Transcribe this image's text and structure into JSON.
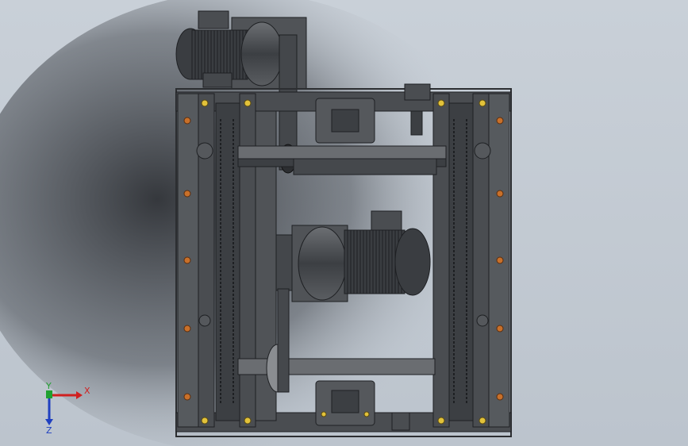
{
  "viewport": {
    "colors": {
      "background": "#c4cbd3",
      "frame": "#4a4d51",
      "frame_dark": "#2c2e31",
      "steel_light": "#8a8d91",
      "bolt_orange": "#c8702a",
      "bolt_yellow": "#e2c23a",
      "axis_x": "#d02020",
      "axis_y": "#20a030",
      "axis_z": "#2040c0"
    }
  },
  "triad": {
    "x_label": "X",
    "y_label": "Y",
    "z_label": "Z"
  }
}
